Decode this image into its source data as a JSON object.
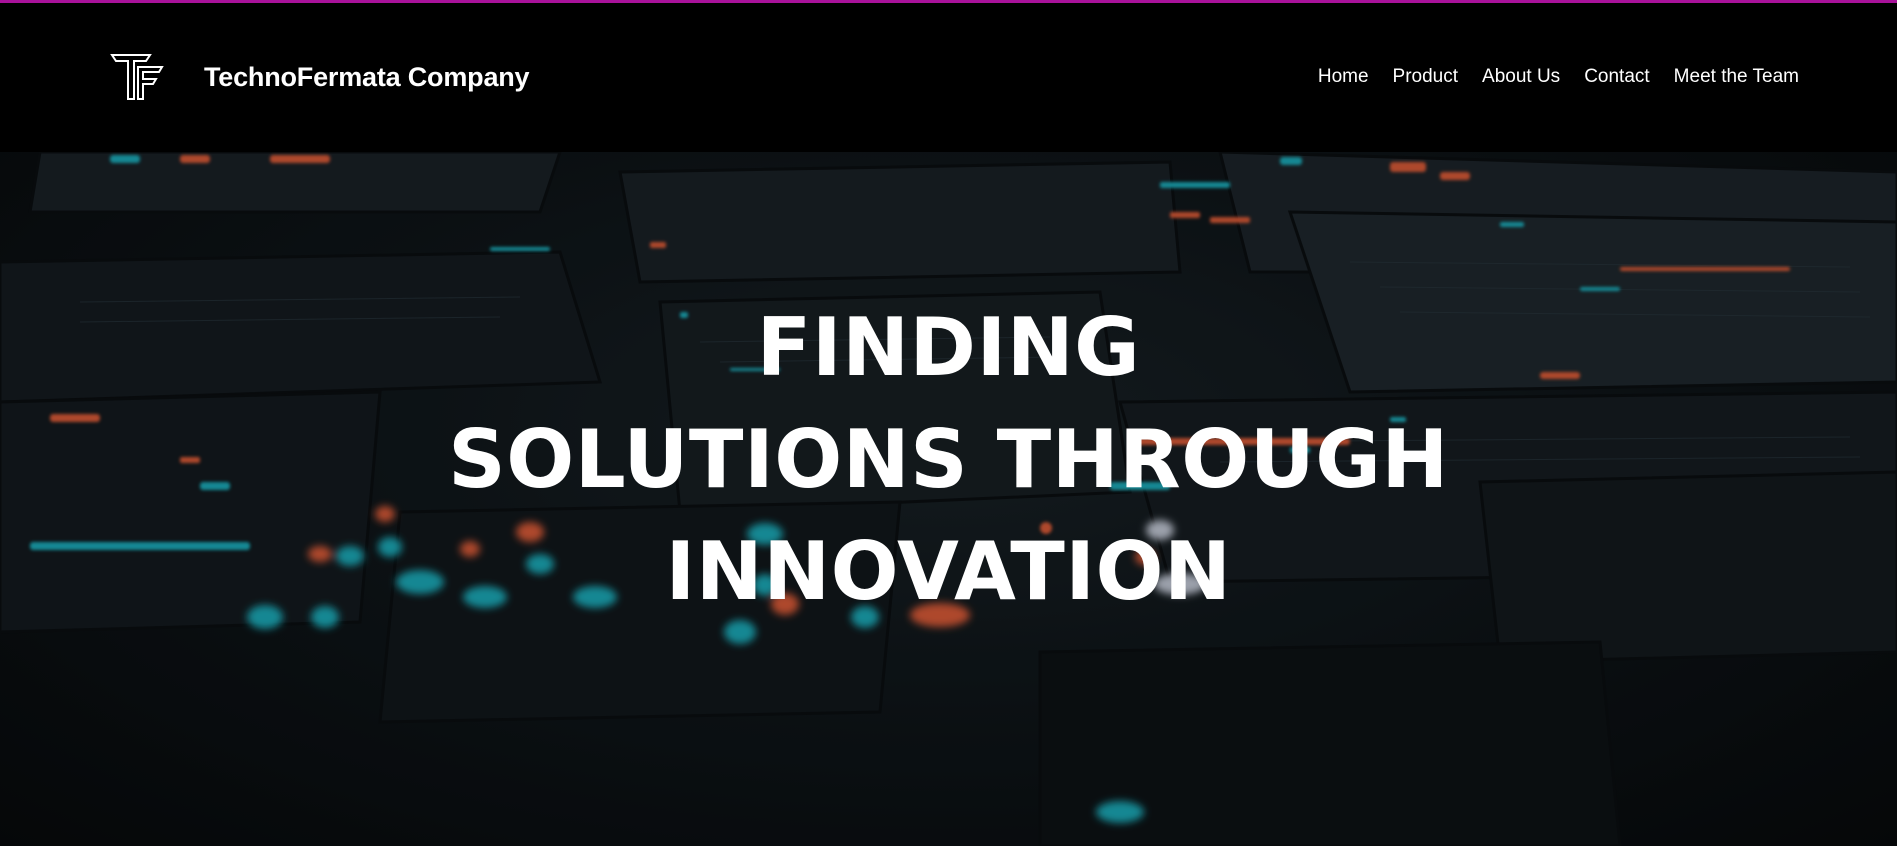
{
  "brand": {
    "logo_icon": "tf-monogram-logo-icon",
    "name": "TechnoFermata Company"
  },
  "nav": {
    "items": [
      {
        "label": "Home"
      },
      {
        "label": "Product"
      },
      {
        "label": "About Us"
      },
      {
        "label": "Contact"
      },
      {
        "label": "Meet the Team"
      }
    ]
  },
  "hero": {
    "title_lines": [
      "FINDING",
      "SOLUTIONS THROUGH",
      "INNOVATION"
    ],
    "background": "abstract circuit boards with teal and orange lights"
  },
  "colors": {
    "accent_bar": "#a8129a",
    "header_bg": "#000000",
    "text": "#ffffff",
    "teal_light": "#1fb5c4",
    "orange_light": "#e8603a"
  }
}
